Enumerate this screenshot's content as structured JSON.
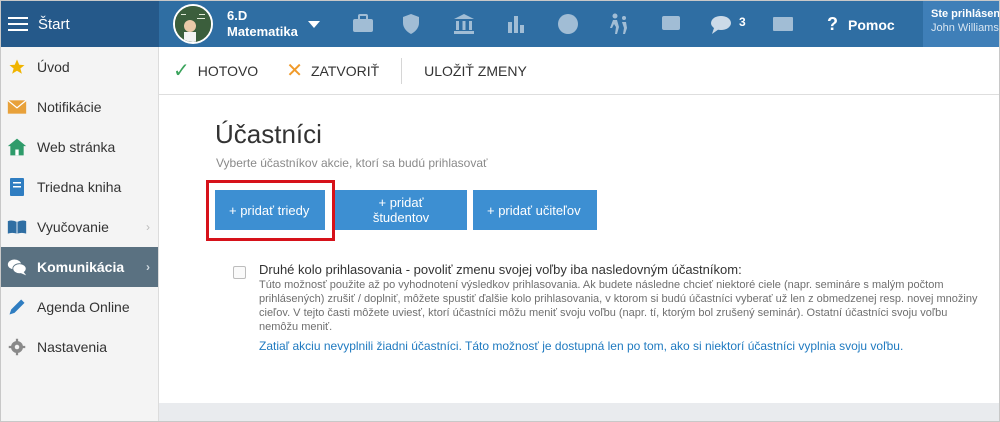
{
  "topbar": {
    "start_label": "Štart",
    "class_name_line1": "6.D",
    "class_name_line2": "Matematika",
    "message_count": "3",
    "help_label": "Pomoc",
    "user_line1": "Ste prihlásený",
    "user_line2": "John Williams",
    "icons": [
      "briefcase-icon",
      "shield-icon",
      "institution-icon",
      "bar-chart-icon",
      "ribbon-icon",
      "people-walking-icon",
      "cast-icon",
      "chat-icon",
      "envelope-icon"
    ]
  },
  "sidebar": {
    "items": [
      {
        "label": "Úvod",
        "icon": "star-icon",
        "color": "#f0b400"
      },
      {
        "label": "Notifikácie",
        "icon": "envelope-icon",
        "color": "#e8a13a"
      },
      {
        "label": "Web stránka",
        "icon": "home-icon",
        "color": "#2e9b6a"
      },
      {
        "label": "Triedna kniha",
        "icon": "book-icon",
        "color": "#2f7dc1"
      },
      {
        "label": "Vyučovanie",
        "icon": "open-book-icon",
        "color": "#2f6ea3"
      },
      {
        "label": "Komunikácia",
        "icon": "chat-icon",
        "color": "#ffffff"
      },
      {
        "label": "Agenda Online",
        "icon": "pen-icon",
        "color": "#2f7dc1"
      },
      {
        "label": "Nastavenia",
        "icon": "gear-icon",
        "color": "#8a8a8a"
      }
    ]
  },
  "toolbar": {
    "done_label": "HOTOVO",
    "close_label": "ZATVORIŤ",
    "save_label": "ULOŽIŤ ZMENY"
  },
  "main": {
    "title": "Účastníci",
    "subtitle": "Vyberte účastníkov akcie, ktorí sa budú prihlasovať",
    "add_classes_label": "+ pridať triedy",
    "add_students_label": "+ pridať študentov",
    "add_teachers_label": "+ pridať učiteľov",
    "option_title": "Druhé kolo prihlasovania - povoliť zmenu svojej voľby iba nasledovným účastníkom:",
    "option_description": "Túto možnosť použite až po vyhodnotení výsledkov prihlasovania. Ak budete následne chcieť niektoré ciele (napr. semináre s malým počtom prihlásených) zrušiť / doplniť, môžete spustiť ďalšie kolo prihlasovania, v ktorom si budú účastníci vyberať už len z obmedzenej resp. novej množiny cieľov. V tejto časti môžete uviesť, ktorí účastníci môžu meniť svoju voľbu (napr. tí, ktorým bol zrušený seminár). Ostatní účastníci svoju voľbu nemôžu meniť.",
    "option_note": "Zatiaľ akciu nevyplnili žiadni účastníci. Táto možnosť je dostupná len po tom, ako si niektorí účastníci vyplnia svoju voľbu.",
    "option_checked": false
  },
  "colors": {
    "topbar": "#2f6ea3",
    "button": "#3d8fd2",
    "highlight": "#d6121a",
    "active_sidebar": "#5a7181",
    "done_check": "#3aa35b",
    "close_x": "#f09a2a"
  }
}
